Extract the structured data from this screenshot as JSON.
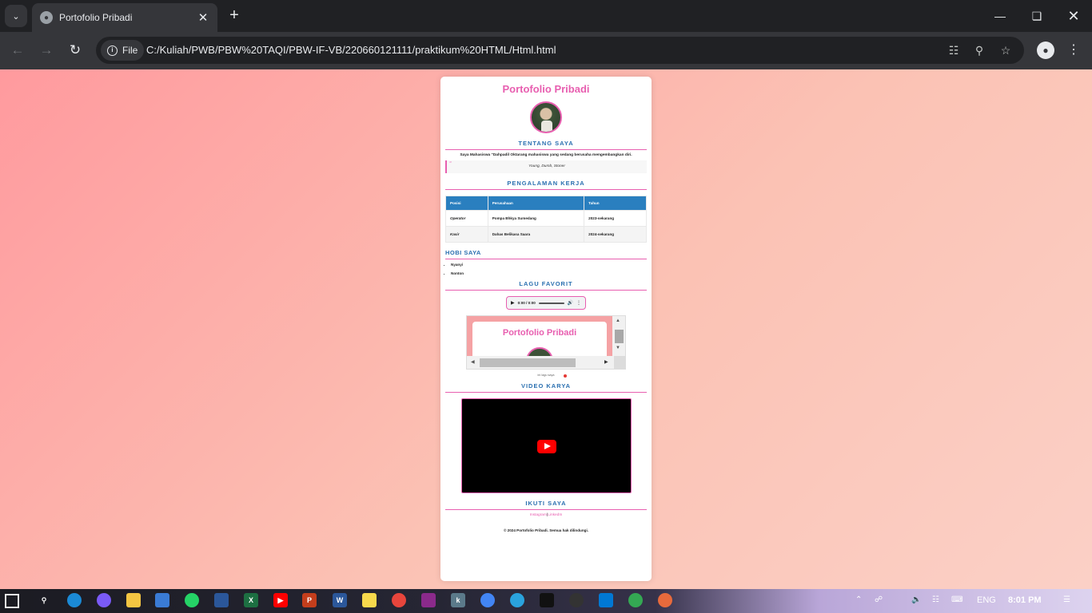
{
  "browser": {
    "tab_title": "Portofolio Pribadi",
    "site_chip": "File",
    "url": "C:/Kuliah/PWB/PBW%20TAQI/PBW-IF-VB/220660121111/praktikum%20HTML/Html.html"
  },
  "page": {
    "title": "Portofolio Pribadi",
    "about": {
      "heading": "TENTANG SAYA",
      "text": "Saya Mahasiswa \"Dahpadil Oktarang mahasiswa yang sedang berusaha mengembangkan diri.",
      "quote": "Young, Dumb, Stoner"
    },
    "experience": {
      "heading": "PENGALAMAN KERJA",
      "columns": [
        "Posisi",
        "Perusahaan",
        "Tahun"
      ],
      "rows": [
        [
          "Operator",
          "Pompa Bhkya Sumedang",
          "2023-sekarang"
        ],
        [
          "Kasir",
          "Dahas Belikasa Saara",
          "2024-sekarang"
        ]
      ]
    },
    "hobbies": {
      "heading": "HOBI SAYA",
      "items": [
        "Nyanyi",
        "Nonton"
      ]
    },
    "songs": {
      "heading": "LAGU FAVORIT",
      "audio_time": "0:00 / 0:00",
      "embed_title": "Portofolio Pribadi",
      "embed_caption": "ini lagu saya"
    },
    "video": {
      "heading": "VIDEO KARYA"
    },
    "follow": {
      "heading": "IKUTI SAYA",
      "links": [
        "Instagram",
        "LinkedIn"
      ],
      "separator": "|"
    },
    "footer": "© 2024 Portofolio Pribadi. Semua hak dilindungi."
  },
  "taskbar": {
    "language": "ENG",
    "time": "8:01 PM"
  }
}
